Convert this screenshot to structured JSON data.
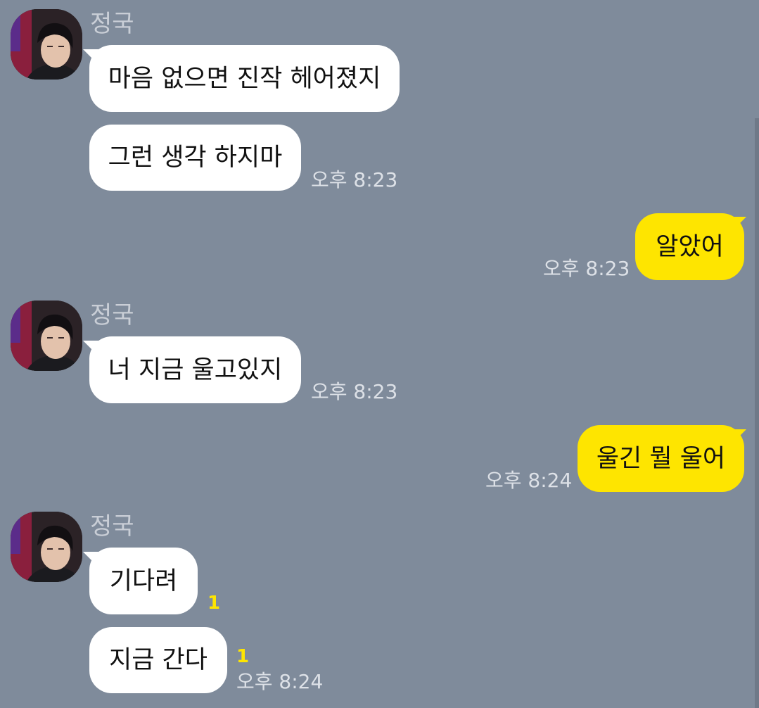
{
  "colors": {
    "background": "#7f8b9b",
    "incoming_bubble": "#ffffff",
    "outgoing_bubble": "#fee500",
    "unread_badge": "#fee500",
    "timestamp": "#dde1e7",
    "sender_name": "#c9ced6"
  },
  "messages": [
    {
      "sender": "정국",
      "avatar_icon": "profile-photo",
      "lines": [
        {
          "text": "마음 없으면 진작 헤어졌지"
        },
        {
          "text": "그런 생각 하지마",
          "time": "오후 8:23"
        }
      ]
    },
    {
      "sender": "me",
      "lines": [
        {
          "text": "알았어",
          "time": "오후 8:23"
        }
      ]
    },
    {
      "sender": "정국",
      "avatar_icon": "profile-photo",
      "lines": [
        {
          "text": "너 지금 울고있지",
          "time": "오후 8:23"
        }
      ]
    },
    {
      "sender": "me",
      "lines": [
        {
          "text": "울긴 뭘 울어",
          "time": "오후 8:24"
        }
      ]
    },
    {
      "sender": "정국",
      "avatar_icon": "profile-photo",
      "lines": [
        {
          "text": "기다려",
          "unread": "1"
        },
        {
          "text": "지금 간다",
          "unread": "1",
          "time": "오후 8:24"
        }
      ]
    }
  ]
}
